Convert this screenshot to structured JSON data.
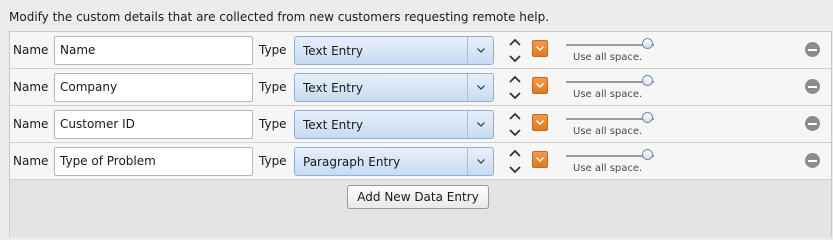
{
  "description": "Modify the custom details that are collected from new customers requesting remote help.",
  "labels": {
    "name": "Name",
    "type": "Type",
    "slider_caption": "Use all space."
  },
  "rows": [
    {
      "name_value": "Name",
      "type_value": "Text Entry"
    },
    {
      "name_value": "Company",
      "type_value": "Text Entry"
    },
    {
      "name_value": "Customer ID",
      "type_value": "Text Entry"
    },
    {
      "name_value": "Type of Problem",
      "type_value": "Paragraph Entry"
    }
  ],
  "add_button_label": "Add New Data Entry",
  "colors": {
    "accent_orange": "#e37820",
    "select_blue": "#c8dbf2",
    "remove_gray": "#8c8c8c"
  },
  "icons": {
    "reorder": "up-down-chevron-icon",
    "menu": "chevron-down-icon",
    "remove": "minus-circle-icon"
  }
}
